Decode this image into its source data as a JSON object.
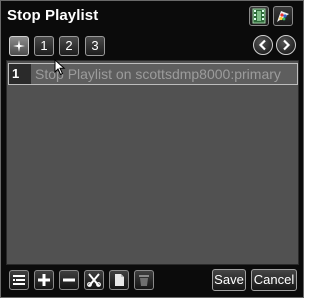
{
  "window": {
    "title": "Stop Playlist"
  },
  "header_icons": [
    "film-icon",
    "palette-icon"
  ],
  "tabs": [
    {
      "icon": "star-icon",
      "label": ""
    },
    {
      "label": "1"
    },
    {
      "label": "2"
    },
    {
      "label": "3"
    }
  ],
  "nav": {
    "prev_icon": "chevron-left-icon",
    "next_icon": "chevron-right-icon"
  },
  "playlist": {
    "rows": [
      {
        "index": "1",
        "text": "Stop Playlist on scottsdmp8000:primary"
      }
    ]
  },
  "toolbar": {
    "icons": [
      "list-icon",
      "plus-icon",
      "minus-icon",
      "scissors-icon",
      "copy-icon",
      "trash-icon"
    ],
    "save_label": "Save",
    "cancel_label": "Cancel"
  },
  "colors": {
    "window_bg": "#0b0b0b",
    "list_bg": "#515151",
    "row_text": "#9c9c9c"
  }
}
